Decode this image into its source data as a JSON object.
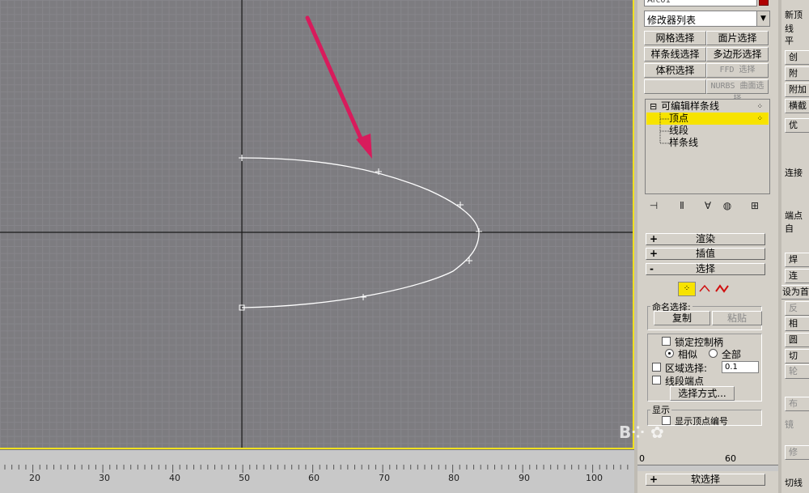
{
  "viewport": {
    "colors": {
      "grid_bg": "#7d7c80",
      "curve": "#ffffff",
      "axis": "#1a1a1a",
      "arrow": "#d81b5c",
      "border": "#f0e020"
    }
  },
  "ruler": {
    "labels": [
      "20",
      "30",
      "40",
      "50",
      "60",
      "70",
      "80",
      "90",
      "100"
    ]
  },
  "modify_panel": {
    "object_name": "Arc01",
    "modifier_list": "修改器列表",
    "buttons": {
      "mesh_select": "网格选择",
      "patch_select": "面片选择",
      "spline_select": "样条线选择",
      "poly_select": "多边形选择",
      "volume_select": "体积选择",
      "ffd_select": "FFD 选择",
      "nurbs_select": "NURBS 曲面选择"
    },
    "stack": {
      "root": "可编辑样条线",
      "items": [
        "顶点",
        "线段",
        "样条线"
      ],
      "selected": "顶点"
    },
    "rollouts": {
      "rendering": "渲染",
      "interpolation": "插值",
      "selection": "选择",
      "soft_selection": "软选择"
    },
    "selection": {
      "named_sel_label": "命名选择:",
      "copy": "复制",
      "paste": "粘贴",
      "lock_handles": "锁定控制柄",
      "similar": "相似",
      "all": "全部",
      "area_select": "区域选择:",
      "area_value": "0.1",
      "segment_end": "线段端点",
      "select_by": "选择方式...",
      "display_label": "显示",
      "show_vertex_numbers": "显示顶点编号"
    },
    "mini_ruler": {
      "left": "0",
      "right": "60"
    }
  },
  "side_panel": {
    "items": [
      "新顶",
      "线",
      "平",
      "创",
      "附",
      "附加",
      "横截",
      "优",
      "连接",
      "端点",
      "自",
      "焊",
      "连",
      "设为首",
      "反",
      "相",
      "圆",
      "切",
      "轮",
      "布",
      "镜",
      "修",
      "切线"
    ]
  }
}
